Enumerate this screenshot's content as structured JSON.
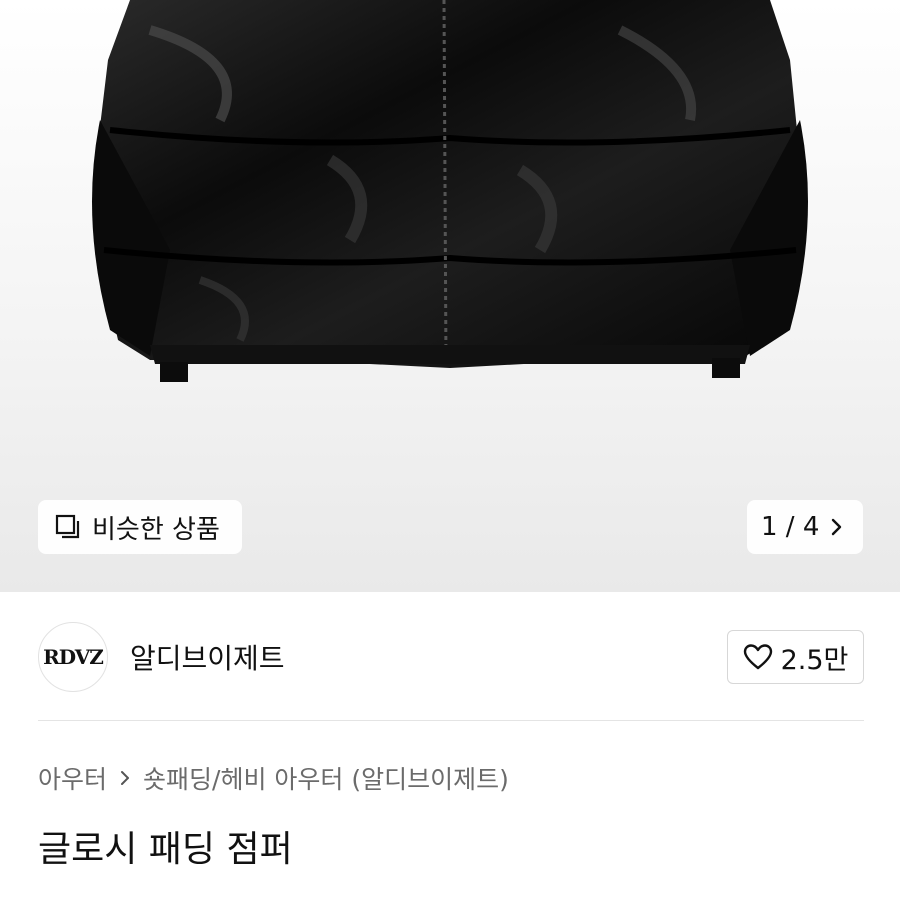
{
  "gallery": {
    "similar_label": "비슷한 상품",
    "counter": "1 / 4"
  },
  "brand": {
    "logo_text": "RDVZ",
    "name": "알디브이제트",
    "like_count": "2.5만"
  },
  "breadcrumb": {
    "category": "아우터",
    "subcategory": "숏패딩/헤비 아우터 (알디브이제트)"
  },
  "product": {
    "title": "글로시 패딩 점퍼"
  }
}
